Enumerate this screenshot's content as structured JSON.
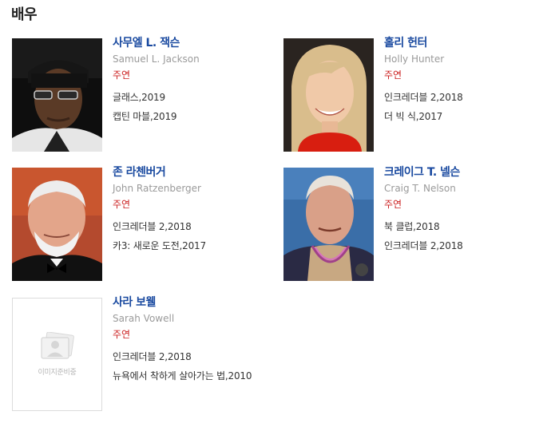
{
  "section": {
    "title": "배우"
  },
  "placeholder": {
    "text": "이미지준비중"
  },
  "actors": [
    {
      "name_ko": "사무엘 L. 잭슨",
      "name_en": "Samuel L. Jackson",
      "role": "주연",
      "works": [
        "글래스,2019",
        "캡틴 마블,2019"
      ]
    },
    {
      "name_ko": "홀리 헌터",
      "name_en": "Holly Hunter",
      "role": "주연",
      "works": [
        "인크레더블 2,2018",
        "더 빅 식,2017"
      ]
    },
    {
      "name_ko": "존 라첸버거",
      "name_en": "John Ratzenberger",
      "role": "주연",
      "works": [
        "인크레더블 2,2018",
        "카3: 새로운 도전,2017"
      ]
    },
    {
      "name_ko": "크레이그 T. 넬슨",
      "name_en": "Craig T. Nelson",
      "role": "주연",
      "works": [
        "북 클럽,2018",
        "인크레더블 2,2018"
      ]
    },
    {
      "name_ko": "사라 보웰",
      "name_en": "Sarah Vowell",
      "role": "주연",
      "works": [
        "인크레더블 2,2018",
        "뉴욕에서 착하게 살아가는 법,2010"
      ]
    }
  ]
}
